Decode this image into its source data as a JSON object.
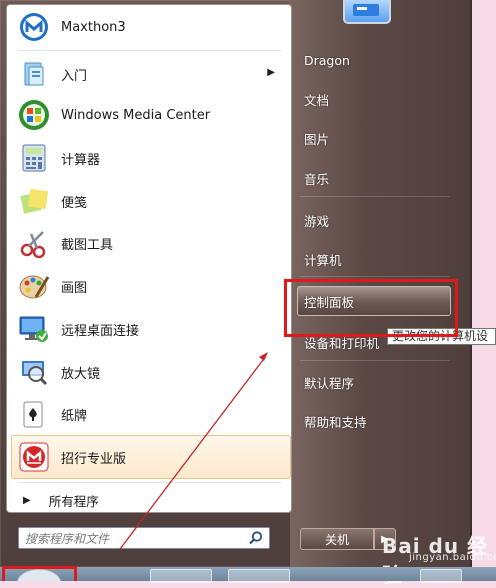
{
  "left_items": [
    {
      "name": "maxthon3",
      "label": "Maxthon3",
      "icon": "maxthon-icon",
      "has_submenu": false
    },
    {
      "name": "getting-started",
      "label": "入门",
      "icon": "getting-started-icon",
      "has_submenu": true
    },
    {
      "name": "windows-media-center",
      "label": "Windows Media Center",
      "icon": "windows-media-center-icon",
      "has_submenu": false
    },
    {
      "name": "calculator",
      "label": "计算器",
      "icon": "calculator-icon",
      "has_submenu": false
    },
    {
      "name": "sticky-notes",
      "label": "便笺",
      "icon": "sticky-notes-icon",
      "has_submenu": false
    },
    {
      "name": "snipping-tool",
      "label": "截图工具",
      "icon": "scissors-icon",
      "has_submenu": false
    },
    {
      "name": "paint",
      "label": "画图",
      "icon": "paint-palette-icon",
      "has_submenu": false
    },
    {
      "name": "remote-desktop",
      "label": "远程桌面连接",
      "icon": "remote-desktop-icon",
      "has_submenu": false
    },
    {
      "name": "magnifier",
      "label": "放大镜",
      "icon": "magnifier-icon",
      "has_submenu": false
    },
    {
      "name": "solitaire",
      "label": "纸牌",
      "icon": "playing-cards-icon",
      "has_submenu": false
    },
    {
      "name": "cmb-professional",
      "label": "招行专业版",
      "icon": "cmb-bank-icon",
      "has_submenu": false,
      "highlighted": true
    }
  ],
  "all_programs": {
    "label": "所有程序",
    "icon": "right-triangle-icon"
  },
  "search": {
    "placeholder": "搜索程序和文件",
    "icon": "search-icon"
  },
  "right_items": {
    "dragon": "Dragon",
    "documents": "文档",
    "pictures": "图片",
    "music": "音乐",
    "games": "游戏",
    "computer": "计算机",
    "control_panel": "控制面板",
    "devices_printers": "设备和打印机",
    "default_programs": "默认程序",
    "help_support": "帮助和支持"
  },
  "tooltip": {
    "text": "更改您的计算机设"
  },
  "shutdown": {
    "label": "关机",
    "arrow": "▶"
  },
  "watermark": {
    "line1": "Bai du 经验",
    "line2": "jingyan.baidu.com"
  },
  "colors": {
    "annotation_red": "#e0191a",
    "pane_bg": "#ffffff",
    "highlight": "#fde9cc"
  }
}
